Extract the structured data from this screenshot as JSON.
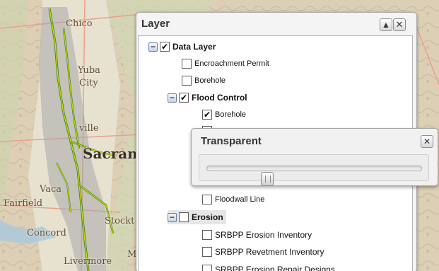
{
  "map": {
    "places": [
      "Chico",
      "Yuba",
      "City",
      "ville",
      "Sacram",
      "Vaca",
      "Fairfield",
      "Concord",
      "Stockt",
      "Livermore",
      "M"
    ]
  },
  "layer_panel": {
    "title": "Layer",
    "collapse_icon": "triangle-up-icon",
    "close_icon": "close-icon",
    "tree": [
      {
        "label": "Data Layer",
        "checked": true,
        "expanded": true,
        "group": true
      },
      {
        "label": "Encroachment Permit",
        "checked": false
      },
      {
        "label": "Borehole",
        "checked": false
      },
      {
        "label": "Flood Control",
        "checked": true,
        "expanded": true,
        "group": true
      },
      {
        "label": "Borehole",
        "checked": true
      },
      {
        "label": "Floodwall Line",
        "checked": false
      },
      {
        "label": "Erosion",
        "checked": false,
        "expanded": true,
        "group": true
      },
      {
        "label": "SRBPP Erosion Inventory",
        "checked": false
      },
      {
        "label": "SRBPP Revetment Inventory",
        "checked": false
      },
      {
        "label": "SRBPP Erosion Repair Designs",
        "checked": false
      }
    ]
  },
  "transparent_panel": {
    "title": "Transparent",
    "close_icon": "close-icon",
    "slider_value_percent": 28
  },
  "colors": {
    "tree_highlight": "#e6e6e6",
    "river_highlight": "#c8e000",
    "levee": "#2c5a1a"
  }
}
